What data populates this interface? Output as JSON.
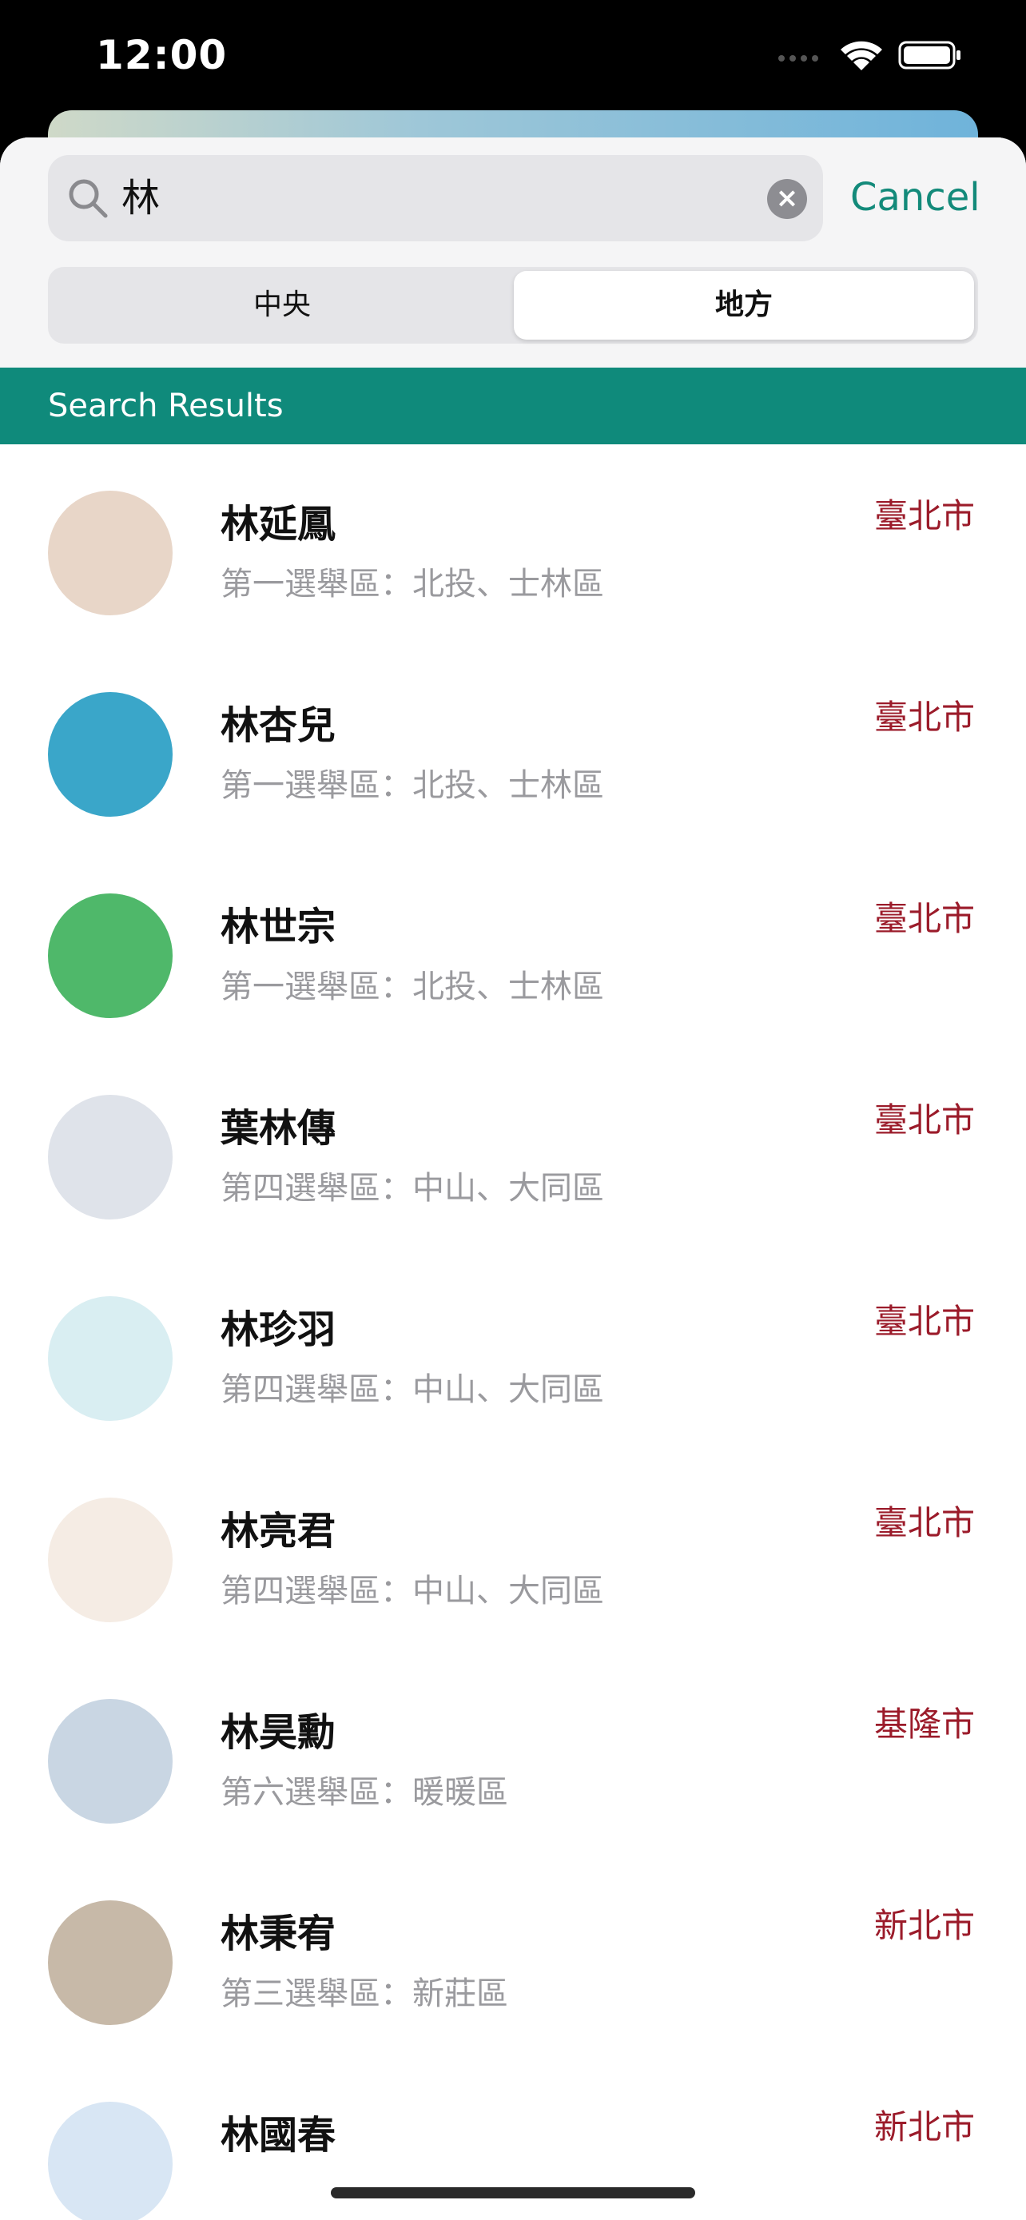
{
  "status_bar": {
    "time": "12:00",
    "icons": [
      "signal-icon",
      "wifi-icon",
      "battery-icon"
    ]
  },
  "search": {
    "query": "林",
    "cancel_label": "Cancel"
  },
  "segments": [
    {
      "label": "中央",
      "selected": false
    },
    {
      "label": "地方",
      "selected": true
    }
  ],
  "results_header": "Search Results",
  "results": [
    {
      "name": "林延鳳",
      "district": "第一選舉區：北投、士林區",
      "city": "臺北市",
      "avatar_color": "#e8d6c8"
    },
    {
      "name": "林杏兒",
      "district": "第一選舉區：北投、士林區",
      "city": "臺北市",
      "avatar_color": "#3aa6c9"
    },
    {
      "name": "林世宗",
      "district": "第一選舉區：北投、士林區",
      "city": "臺北市",
      "avatar_color": "#4fb86a"
    },
    {
      "name": "葉林傳",
      "district": "第四選舉區：中山、大同區",
      "city": "臺北市",
      "avatar_color": "#dfe3ea"
    },
    {
      "name": "林珍羽",
      "district": "第四選舉區：中山、大同區",
      "city": "臺北市",
      "avatar_color": "#d9eef2"
    },
    {
      "name": "林亮君",
      "district": "第四選舉區：中山、大同區",
      "city": "臺北市",
      "avatar_color": "#f5ece4"
    },
    {
      "name": "林昊勳",
      "district": "第六選舉區：暖暖區",
      "city": "基隆市",
      "avatar_color": "#c9d6e3"
    },
    {
      "name": "林秉宥",
      "district": "第三選舉區：新莊區",
      "city": "新北市",
      "avatar_color": "#c7b9a8"
    },
    {
      "name": "林國春",
      "district": "",
      "city": "新北市",
      "avatar_color": "#d8e6f4"
    }
  ],
  "colors": {
    "accent": "#138a7a",
    "header_bg": "#0f8a7b",
    "city_text": "#9b1b2a",
    "secondary_text": "#9a9a9e"
  }
}
